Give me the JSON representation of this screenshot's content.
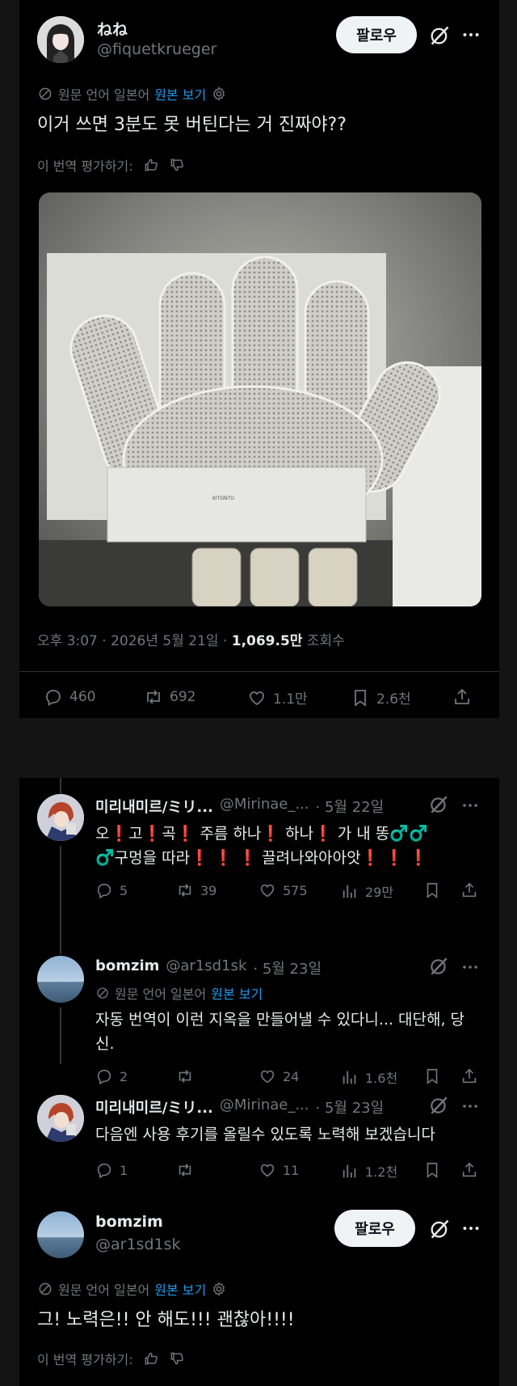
{
  "tweet": {
    "author_name": "ねね",
    "author_handle": "@fiquetkrueger",
    "follow_label": "팔로우",
    "translation": {
      "prefix": "원문 언어 일본어",
      "link": "원본 보기"
    },
    "text": "이거 쓰면 3분도 못 버틴다는 거 진짜야??",
    "rate_label": "이 번역 평가하기:",
    "meta": {
      "time_date": "오후 3:07 · 2026년 5월 21일 · ",
      "views": "1,069.5만",
      "views_label": " 조회수"
    },
    "stats": {
      "replies": "460",
      "retweets": "692",
      "likes": "1.1만",
      "bookmarks": "2.6천"
    }
  },
  "replies": [
    {
      "author_name": "미리내미르/ミリ...",
      "author_handle": "@Mirinae_...",
      "date": "· 5월 22일",
      "line1": "오❗고❗곡❗ 주름 하나❗ 하나❗ 가 내 똥♂️♂️",
      "line2": "♂️구멍을 따라❗ ❗ ❗ 끌려나와아아앗❗ ❗ ❗",
      "stats": {
        "replies": "5",
        "retweets": "39",
        "likes": "575",
        "views": "29만"
      }
    },
    {
      "author_name": "bomzim",
      "author_handle": "@ar1sd1sk",
      "date": "· 5월 23일",
      "translation": {
        "prefix": "원문 언어 일본어",
        "link": "원본 보기"
      },
      "line1": "자동 번역이 이런 지옥을 만들어낼 수 있다니... 대단해, 당",
      "line2": "신.",
      "stats": {
        "replies": "2",
        "retweets": "",
        "likes": "24",
        "views": "1.6천"
      }
    },
    {
      "author_name": "미리내미르/ミリ...",
      "author_handle": "@Mirinae_...",
      "date": "· 5월 23일",
      "line1": "다음엔 사용 후기를 올릴수 있도록 노력해 보겠습니다",
      "stats": {
        "replies": "1",
        "retweets": "",
        "likes": "11",
        "views": "1.2천"
      }
    }
  ],
  "final_reply": {
    "author_name": "bomzim",
    "author_handle": "@ar1sd1sk",
    "follow_label": "팔로우",
    "translation": {
      "prefix": "원문 언어 일본어",
      "link": "원본 보기"
    },
    "text": "그! 노력은!! 안 해도!!! 괜찮아!!!!",
    "rate_label": "이 번역 평가하기:"
  },
  "photo": {
    "brand_text": "KITONTO"
  }
}
